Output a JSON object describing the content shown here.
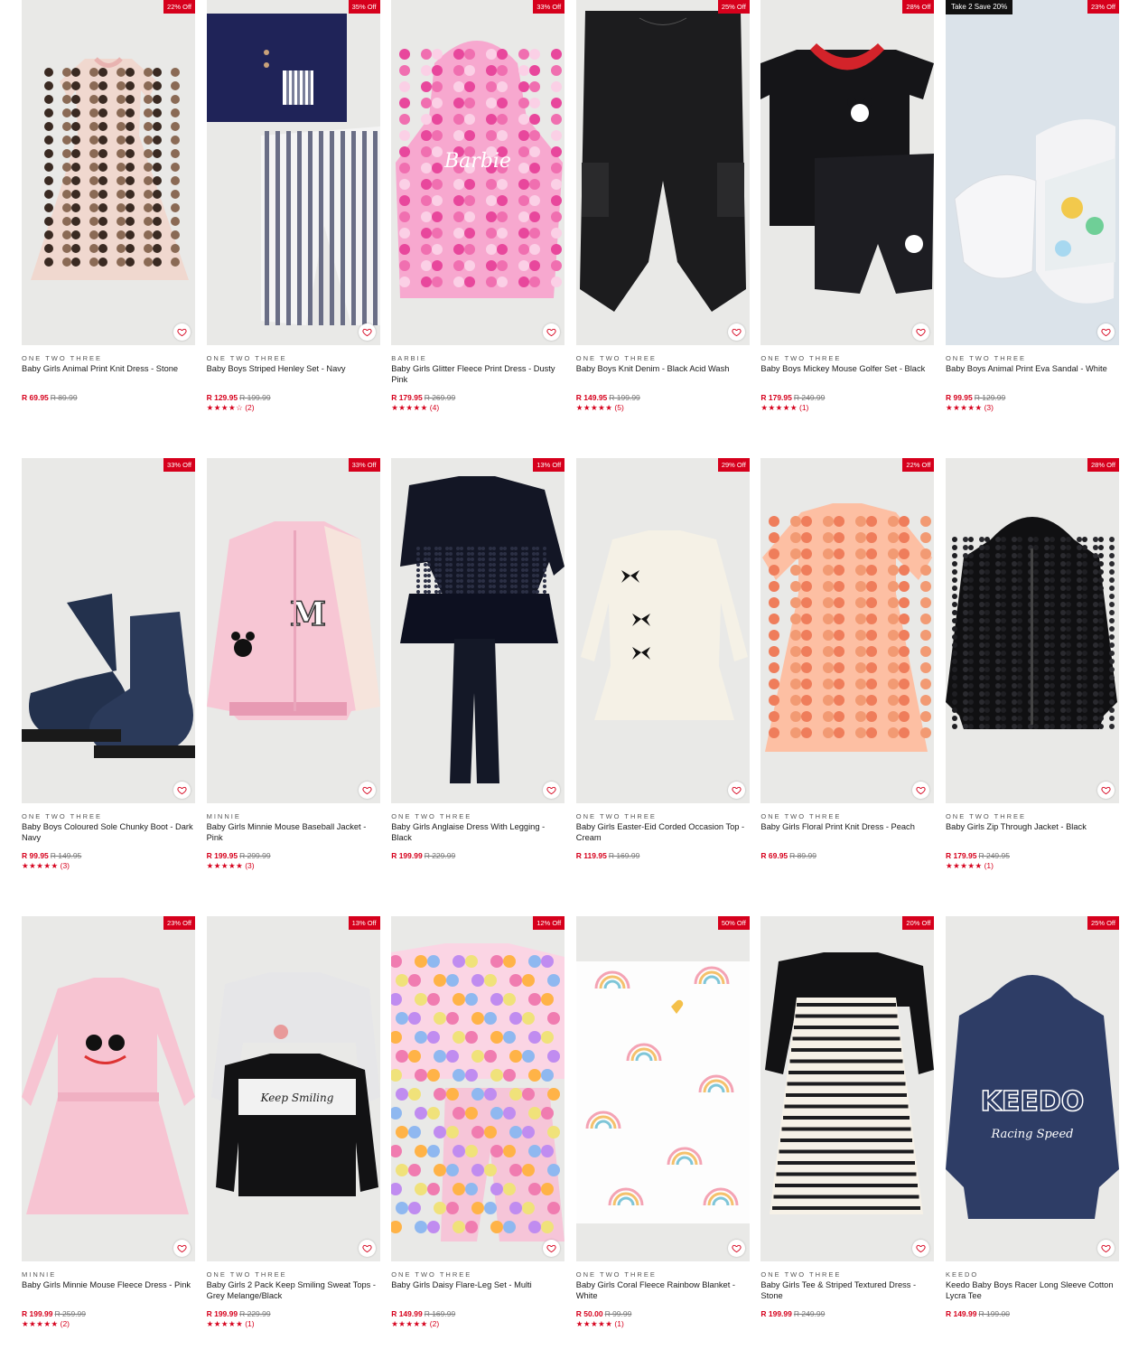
{
  "wishlist_icon": "heart-icon",
  "colors": {
    "accent": "#d6001c",
    "image_bg": "#e9e9e7",
    "promo_bg": "#111111"
  },
  "products": [
    {
      "brand": "ONE TWO THREE",
      "name": "Baby Girls Animal Print Knit Dress - Stone",
      "price": "R 69.95",
      "was": "R 89.99",
      "discount": "22% Off",
      "promo": "",
      "stars": "",
      "reviews": "",
      "art": "dress-leopard"
    },
    {
      "brand": "ONE TWO THREE",
      "name": "Baby Boys Striped Henley Set - Navy",
      "price": "R 129.95",
      "was": "R 199.99",
      "discount": "35% Off",
      "promo": "",
      "stars": "★★★★☆",
      "reviews": "(2)",
      "art": "henley-set"
    },
    {
      "brand": "BARBIE",
      "name": "Baby Girls Glitter Fleece Print Dress - Dusty Pink",
      "price": "R 179.95",
      "was": "R 269.99",
      "discount": "33% Off",
      "promo": "",
      "stars": "★★★★★",
      "reviews": "(4)",
      "art": "barbie-hoodie"
    },
    {
      "brand": "ONE TWO THREE",
      "name": "Baby Boys Knit Denim - Black Acid Wash",
      "price": "R 149.95",
      "was": "R 199.99",
      "discount": "25% Off",
      "promo": "",
      "stars": "★★★★★",
      "reviews": "(5)",
      "art": "black-pants"
    },
    {
      "brand": "ONE TWO THREE",
      "name": "Baby Boys Mickey Mouse Golfer Set - Black",
      "price": "R 179.95",
      "was": "R 249.99",
      "discount": "28% Off",
      "promo": "",
      "stars": "★★★★★",
      "reviews": "(1)",
      "art": "golfer-set"
    },
    {
      "brand": "ONE TWO THREE",
      "name": "Baby Boys Animal Print Eva Sandal - White",
      "price": "R 99.95",
      "was": "R 129.99",
      "discount": "23% Off",
      "promo": "Take 2 Save 20%",
      "stars": "★★★★★",
      "reviews": "(3)",
      "art": "sandal"
    },
    {
      "brand": "ONE TWO THREE",
      "name": "Baby Boys Coloured Sole Chunky Boot - Dark Navy",
      "price": "R 99.95",
      "was": "R 149.95",
      "discount": "33% Off",
      "promo": "",
      "stars": "★★★★★",
      "reviews": "(3)",
      "art": "boots"
    },
    {
      "brand": "MINNIE",
      "name": "Baby Girls Minnie Mouse Baseball Jacket - Pink",
      "price": "R 199.95",
      "was": "R 299.99",
      "discount": "33% Off",
      "promo": "",
      "stars": "★★★★★",
      "reviews": "(3)",
      "art": "baseball-jacket"
    },
    {
      "brand": "ONE TWO THREE",
      "name": "Baby Girls Anglaise Dress With Legging - Black",
      "price": "R 199.99",
      "was": "R 229.99",
      "discount": "13% Off",
      "promo": "",
      "stars": "",
      "reviews": "",
      "art": "black-dress-set"
    },
    {
      "brand": "ONE TWO THREE",
      "name": "Baby Girls Easter-Eid Corded Occasion Top - Cream",
      "price": "R 119.95",
      "was": "R 169.99",
      "discount": "29% Off",
      "promo": "",
      "stars": "",
      "reviews": "",
      "art": "cream-top"
    },
    {
      "brand": "ONE TWO THREE",
      "name": "Baby Girls Floral Print Knit Dress - Peach",
      "price": "R 69.95",
      "was": "R 89.99",
      "discount": "22% Off",
      "promo": "",
      "stars": "",
      "reviews": "",
      "art": "peach-dress"
    },
    {
      "brand": "ONE TWO THREE",
      "name": "Baby Girls Zip Through Jacket - Black",
      "price": "R 179.95",
      "was": "R 249.95",
      "discount": "28% Off",
      "promo": "",
      "stars": "★★★★★",
      "reviews": "(1)",
      "art": "fur-jacket"
    },
    {
      "brand": "MINNIE",
      "name": "Baby Girls Minnie Mouse Fleece Dress - Pink",
      "price": "R 199.99",
      "was": "R 259.99",
      "discount": "23% Off",
      "promo": "",
      "stars": "★★★★★",
      "reviews": "(2)",
      "art": "pink-fleece-dress"
    },
    {
      "brand": "ONE TWO THREE",
      "name": "Baby Girls 2 Pack Keep Smiling Sweat Tops - Grey Melange/Black",
      "price": "R 199.99",
      "was": "R 229.99",
      "discount": "13% Off",
      "promo": "",
      "stars": "★★★★★",
      "reviews": "(1)",
      "art": "sweat-tops"
    },
    {
      "brand": "ONE TWO THREE",
      "name": "Baby Girls Daisy Flare-Leg Set - Multi",
      "price": "R 149.99",
      "was": "R 169.99",
      "discount": "12% Off",
      "promo": "",
      "stars": "★★★★★",
      "reviews": "(2)",
      "art": "daisy-set"
    },
    {
      "brand": "ONE TWO THREE",
      "name": "Baby Girls Coral Fleece Rainbow Blanket - White",
      "price": "R 50.00",
      "was": "R 99.99",
      "discount": "50% Off",
      "promo": "",
      "stars": "★★★★★",
      "reviews": "(1)",
      "art": "rainbow-blanket"
    },
    {
      "brand": "ONE TWO THREE",
      "name": "Baby Girls Tee & Striped Textured Dress - Stone",
      "price": "R 199.99",
      "was": "R 249.99",
      "discount": "20% Off",
      "promo": "",
      "stars": "",
      "reviews": "",
      "art": "striped-dress"
    },
    {
      "brand": "KEEDO",
      "name": "Keedo Baby Boys Racer Long Sleeve Cotton Lycra Tee",
      "price": "R 149.99",
      "was": "R 199.00",
      "discount": "25% Off",
      "promo": "",
      "stars": "",
      "reviews": "",
      "art": "keedo-hoodie"
    }
  ]
}
